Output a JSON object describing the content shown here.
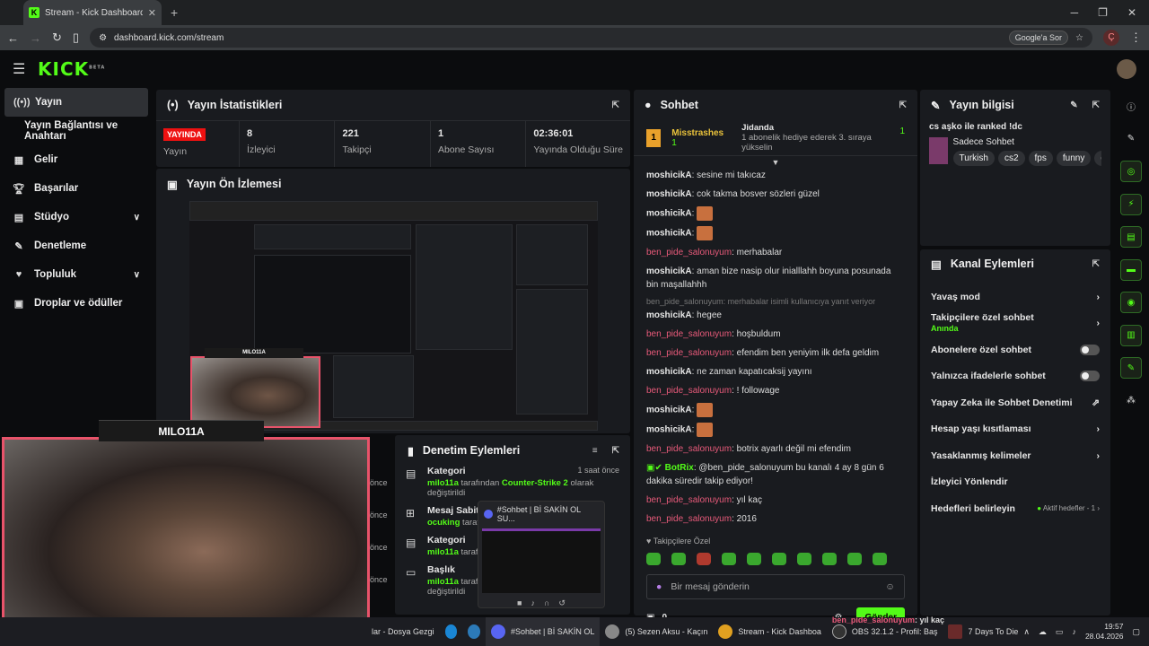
{
  "browser": {
    "tab_title": "Stream - Kick Dashboard",
    "url": "dashboard.kick.com/stream",
    "google_label": "Google'a Sor",
    "profile_letter": "Ç"
  },
  "brand": {
    "logo": "KICK",
    "beta": "BETA"
  },
  "sidebar": {
    "items": [
      {
        "label": "Yayın",
        "icon": "broadcast-icon"
      },
      {
        "label": "Yayın Bağlantısı ve Anahtarı",
        "icon": ""
      },
      {
        "label": "Gelir",
        "icon": "chart-icon"
      },
      {
        "label": "Başarılar",
        "icon": "trophy-icon"
      },
      {
        "label": "Stüdyo",
        "icon": "studio-icon"
      },
      {
        "label": "Denetleme",
        "icon": "wrench-icon"
      },
      {
        "label": "Topluluk",
        "icon": "community-icon"
      },
      {
        "label": "Droplar ve ödüller",
        "icon": "gift-icon"
      }
    ]
  },
  "stats": {
    "title": "Yayın İstatistikleri",
    "live_badge": "YAYINDA",
    "live_label": "Yayın",
    "items": [
      {
        "value": "8",
        "label": "İzleyici"
      },
      {
        "value": "221",
        "label": "Takipçi"
      },
      {
        "value": "1",
        "label": "Abone Sayısı"
      },
      {
        "value": "02:36:01",
        "label": "Yayında Olduğu Süre"
      }
    ]
  },
  "preview": {
    "title": "Yayın Ön İzlemesi"
  },
  "cams": {
    "small_label": "MILO11A",
    "big_label": "MILO11A"
  },
  "chat": {
    "title": "Sohbet",
    "pinned_user": "Misstrashes",
    "pinned_count": "1",
    "gift_user": "Jidanda",
    "gift_text": "1 abonelik hediye ederek 3. sıraya yükselin",
    "gift_count": "1",
    "messages": [
      {
        "user": "moshicikA",
        "text": "sesine mi takıcaz",
        "type": "u1"
      },
      {
        "user": "moshicikA",
        "text": "cok takma bosver sözleri güzel",
        "type": "u1"
      },
      {
        "user": "moshicikA",
        "text": "",
        "type": "u1",
        "emote": true
      },
      {
        "user": "moshicikA",
        "text": "",
        "type": "u1",
        "emote": true
      },
      {
        "user": "ben_pide_salonuyum",
        "text": "merhabalar",
        "type": "u2"
      },
      {
        "user": "moshicikA",
        "text": "aman bize nasip olur inialllahh boyuna posunada bin maşallahhh",
        "type": "u1"
      },
      {
        "user": "moshicikA",
        "text": "hegee",
        "type": "u1",
        "reply": "ben_pide_salonuyum: merhabalar isimli kullanıcıya yanıt veriyor"
      },
      {
        "user": "ben_pide_salonuyum",
        "text": "hoşbuldum",
        "type": "u2"
      },
      {
        "user": "ben_pide_salonuyum",
        "text": "efendim ben yeniyim ilk defa geldim",
        "type": "u2"
      },
      {
        "user": "moshicikA",
        "text": "ne zaman kapatıcaksij yayını",
        "type": "u1"
      },
      {
        "user": "ben_pide_salonuyum",
        "text": "! followage",
        "type": "u2"
      },
      {
        "user": "moshicikA",
        "text": "",
        "type": "u1",
        "emote": true
      },
      {
        "user": "moshicikA",
        "text": "",
        "type": "u1",
        "emote": true
      },
      {
        "user": "ben_pide_salonuyum",
        "text": "botrix ayarlı değil mi efendim",
        "type": "u2"
      },
      {
        "user": "BotRix",
        "text": "@ben_pide_salonuyum bu kanalı 4 ay 8 gün 6 dakika süredir takip ediyor!",
        "type": "bot"
      },
      {
        "user": "ben_pide_salonuyum",
        "text": "yıl kaç",
        "type": "u2"
      },
      {
        "user": "ben_pide_salonuyum",
        "text": "2016",
        "type": "u2"
      }
    ],
    "followers_only": "Takipçilere Özel",
    "placeholder": "Bir mesaj gönderin",
    "count": "0",
    "send": "Gönder"
  },
  "info": {
    "title": "Yayın bilgisi",
    "stream_title": "cs aşko ile ranked !dc",
    "category": "Sadece Sohbet",
    "tags": [
      "Turkish",
      "cs2",
      "fps",
      "funny",
      "g"
    ]
  },
  "actions": {
    "title": "Kanal Eylemleri",
    "items": [
      {
        "label": "Yavaş mod",
        "ctl": "chev"
      },
      {
        "label": "Takipçilere özel sohbet",
        "sub": "Anında",
        "ctl": "chev"
      },
      {
        "label": "Abonelere özel sohbet",
        "ctl": "toggle"
      },
      {
        "label": "Yalnızca ifadelerle sohbet",
        "ctl": "toggle"
      },
      {
        "label": "Yapay Zeka ile Sohbet Denetimi",
        "ctl": "ext"
      },
      {
        "label": "Hesap yaşı kısıtlaması",
        "ctl": "chev"
      },
      {
        "label": "Yasaklanmış kelimeler",
        "ctl": "chev"
      },
      {
        "label": "İzleyici Yönlendir",
        "ctl": ""
      },
      {
        "label": "Hedefleri belirleyin",
        "ctl": "chev",
        "extra": "Aktif hedefler - 1"
      }
    ]
  },
  "moderation": {
    "title": "Denetim Eylemleri",
    "rows": [
      {
        "title": "Kategori",
        "who": "milo11a",
        "mid": " tarafından ",
        "val": "Counter-Strike 2",
        "tail": " olarak değiştirildi",
        "time": "1 saat önce",
        "icon": "category-icon"
      },
      {
        "title": "Mesaj Sabitle",
        "who": "ocuking",
        "mid": " tarafı",
        "val": "",
        "tail": "",
        "time": "",
        "icon": "pin-icon"
      },
      {
        "title": "Kategori",
        "who": "milo11a",
        "mid": " tarafı",
        "val": "",
        "tail": "",
        "time": "",
        "icon": "category-icon"
      },
      {
        "title": "Başlık",
        "who": "milo11a",
        "mid": " tarafı",
        "val": "",
        "tail": " değiştirildi",
        "time": "",
        "icon": "title-icon"
      }
    ],
    "side_labels": [
      "önce",
      "önce",
      "önce",
      "önce"
    ]
  },
  "discord": {
    "title": "#Sohbet | Bİ SAKİN OL SU..."
  },
  "taskbar": {
    "items": [
      "lar - Dosya Gezgi",
      "#Sohbet | Bİ SAKİN OL",
      "(5) Sezen Aksu - Kaçın",
      "Stream - Kick Dashboa",
      "OBS 32.1.2 - Profil: Baş",
      "7 Days To Die"
    ],
    "overlay_user": "ben_pide_salonuyum",
    "overlay_text": ": yıl kaç",
    "time": "19:57",
    "date": "28.04.2026"
  }
}
